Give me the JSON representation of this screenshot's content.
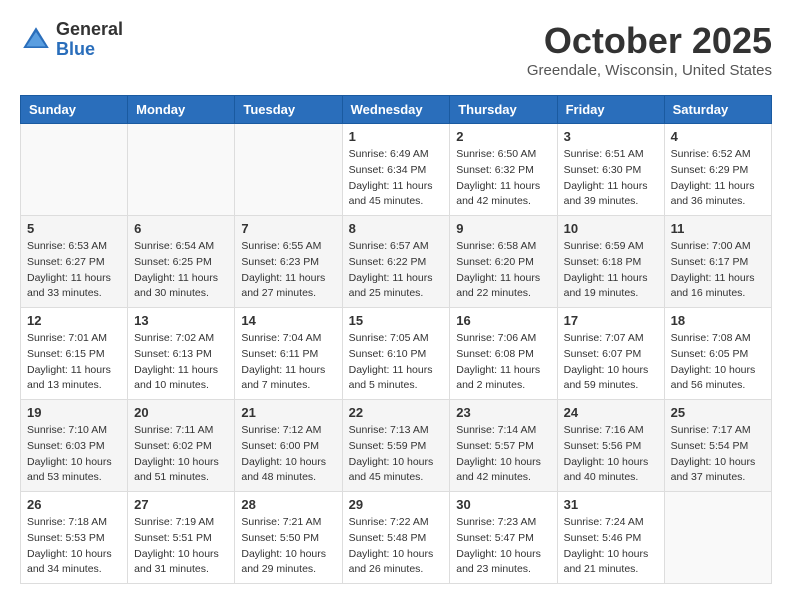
{
  "logo": {
    "general": "General",
    "blue": "Blue"
  },
  "title": "October 2025",
  "location": "Greendale, Wisconsin, United States",
  "days_of_week": [
    "Sunday",
    "Monday",
    "Tuesday",
    "Wednesday",
    "Thursday",
    "Friday",
    "Saturday"
  ],
  "weeks": [
    [
      {
        "day": "",
        "info": ""
      },
      {
        "day": "",
        "info": ""
      },
      {
        "day": "",
        "info": ""
      },
      {
        "day": "1",
        "info": "Sunrise: 6:49 AM\nSunset: 6:34 PM\nDaylight: 11 hours\nand 45 minutes."
      },
      {
        "day": "2",
        "info": "Sunrise: 6:50 AM\nSunset: 6:32 PM\nDaylight: 11 hours\nand 42 minutes."
      },
      {
        "day": "3",
        "info": "Sunrise: 6:51 AM\nSunset: 6:30 PM\nDaylight: 11 hours\nand 39 minutes."
      },
      {
        "day": "4",
        "info": "Sunrise: 6:52 AM\nSunset: 6:29 PM\nDaylight: 11 hours\nand 36 minutes."
      }
    ],
    [
      {
        "day": "5",
        "info": "Sunrise: 6:53 AM\nSunset: 6:27 PM\nDaylight: 11 hours\nand 33 minutes."
      },
      {
        "day": "6",
        "info": "Sunrise: 6:54 AM\nSunset: 6:25 PM\nDaylight: 11 hours\nand 30 minutes."
      },
      {
        "day": "7",
        "info": "Sunrise: 6:55 AM\nSunset: 6:23 PM\nDaylight: 11 hours\nand 27 minutes."
      },
      {
        "day": "8",
        "info": "Sunrise: 6:57 AM\nSunset: 6:22 PM\nDaylight: 11 hours\nand 25 minutes."
      },
      {
        "day": "9",
        "info": "Sunrise: 6:58 AM\nSunset: 6:20 PM\nDaylight: 11 hours\nand 22 minutes."
      },
      {
        "day": "10",
        "info": "Sunrise: 6:59 AM\nSunset: 6:18 PM\nDaylight: 11 hours\nand 19 minutes."
      },
      {
        "day": "11",
        "info": "Sunrise: 7:00 AM\nSunset: 6:17 PM\nDaylight: 11 hours\nand 16 minutes."
      }
    ],
    [
      {
        "day": "12",
        "info": "Sunrise: 7:01 AM\nSunset: 6:15 PM\nDaylight: 11 hours\nand 13 minutes."
      },
      {
        "day": "13",
        "info": "Sunrise: 7:02 AM\nSunset: 6:13 PM\nDaylight: 11 hours\nand 10 minutes."
      },
      {
        "day": "14",
        "info": "Sunrise: 7:04 AM\nSunset: 6:11 PM\nDaylight: 11 hours\nand 7 minutes."
      },
      {
        "day": "15",
        "info": "Sunrise: 7:05 AM\nSunset: 6:10 PM\nDaylight: 11 hours\nand 5 minutes."
      },
      {
        "day": "16",
        "info": "Sunrise: 7:06 AM\nSunset: 6:08 PM\nDaylight: 11 hours\nand 2 minutes."
      },
      {
        "day": "17",
        "info": "Sunrise: 7:07 AM\nSunset: 6:07 PM\nDaylight: 10 hours\nand 59 minutes."
      },
      {
        "day": "18",
        "info": "Sunrise: 7:08 AM\nSunset: 6:05 PM\nDaylight: 10 hours\nand 56 minutes."
      }
    ],
    [
      {
        "day": "19",
        "info": "Sunrise: 7:10 AM\nSunset: 6:03 PM\nDaylight: 10 hours\nand 53 minutes."
      },
      {
        "day": "20",
        "info": "Sunrise: 7:11 AM\nSunset: 6:02 PM\nDaylight: 10 hours\nand 51 minutes."
      },
      {
        "day": "21",
        "info": "Sunrise: 7:12 AM\nSunset: 6:00 PM\nDaylight: 10 hours\nand 48 minutes."
      },
      {
        "day": "22",
        "info": "Sunrise: 7:13 AM\nSunset: 5:59 PM\nDaylight: 10 hours\nand 45 minutes."
      },
      {
        "day": "23",
        "info": "Sunrise: 7:14 AM\nSunset: 5:57 PM\nDaylight: 10 hours\nand 42 minutes."
      },
      {
        "day": "24",
        "info": "Sunrise: 7:16 AM\nSunset: 5:56 PM\nDaylight: 10 hours\nand 40 minutes."
      },
      {
        "day": "25",
        "info": "Sunrise: 7:17 AM\nSunset: 5:54 PM\nDaylight: 10 hours\nand 37 minutes."
      }
    ],
    [
      {
        "day": "26",
        "info": "Sunrise: 7:18 AM\nSunset: 5:53 PM\nDaylight: 10 hours\nand 34 minutes."
      },
      {
        "day": "27",
        "info": "Sunrise: 7:19 AM\nSunset: 5:51 PM\nDaylight: 10 hours\nand 31 minutes."
      },
      {
        "day": "28",
        "info": "Sunrise: 7:21 AM\nSunset: 5:50 PM\nDaylight: 10 hours\nand 29 minutes."
      },
      {
        "day": "29",
        "info": "Sunrise: 7:22 AM\nSunset: 5:48 PM\nDaylight: 10 hours\nand 26 minutes."
      },
      {
        "day": "30",
        "info": "Sunrise: 7:23 AM\nSunset: 5:47 PM\nDaylight: 10 hours\nand 23 minutes."
      },
      {
        "day": "31",
        "info": "Sunrise: 7:24 AM\nSunset: 5:46 PM\nDaylight: 10 hours\nand 21 minutes."
      },
      {
        "day": "",
        "info": ""
      }
    ]
  ]
}
